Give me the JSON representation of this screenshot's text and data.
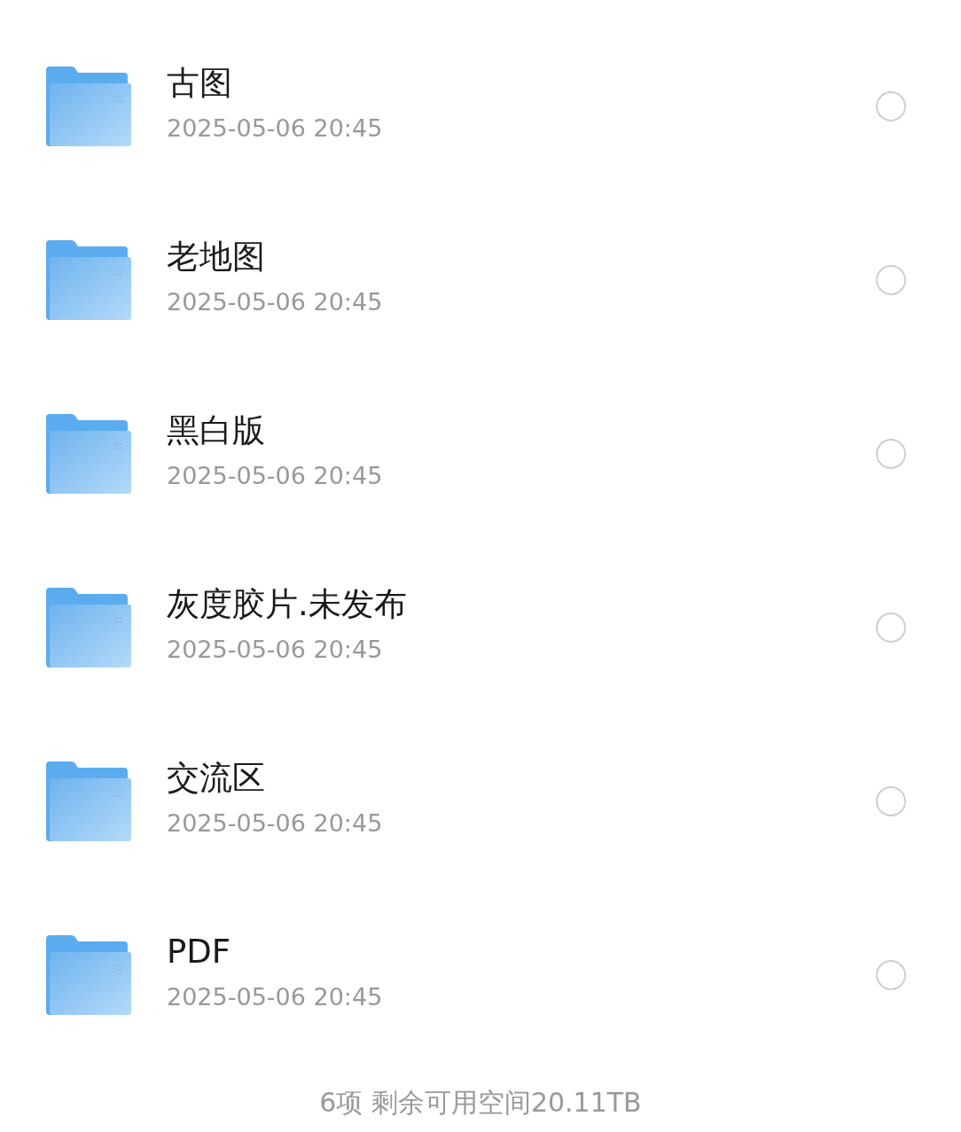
{
  "files": [
    {
      "name": "古图",
      "date": "2025-05-06 20:45",
      "selected": false
    },
    {
      "name": "老地图",
      "date": "2025-05-06 20:45",
      "selected": false
    },
    {
      "name": "黑白版",
      "date": "2025-05-06 20:45",
      "selected": false
    },
    {
      "name": "灰度胶片.未发布",
      "date": "2025-05-06 20:45",
      "selected": false
    },
    {
      "name": "交流区",
      "date": "2025-05-06 20:45",
      "selected": false
    },
    {
      "name": "PDF",
      "date": "2025-05-06 20:45",
      "selected": false
    }
  ],
  "footer": "6项 剩余可用空间20.11TB"
}
